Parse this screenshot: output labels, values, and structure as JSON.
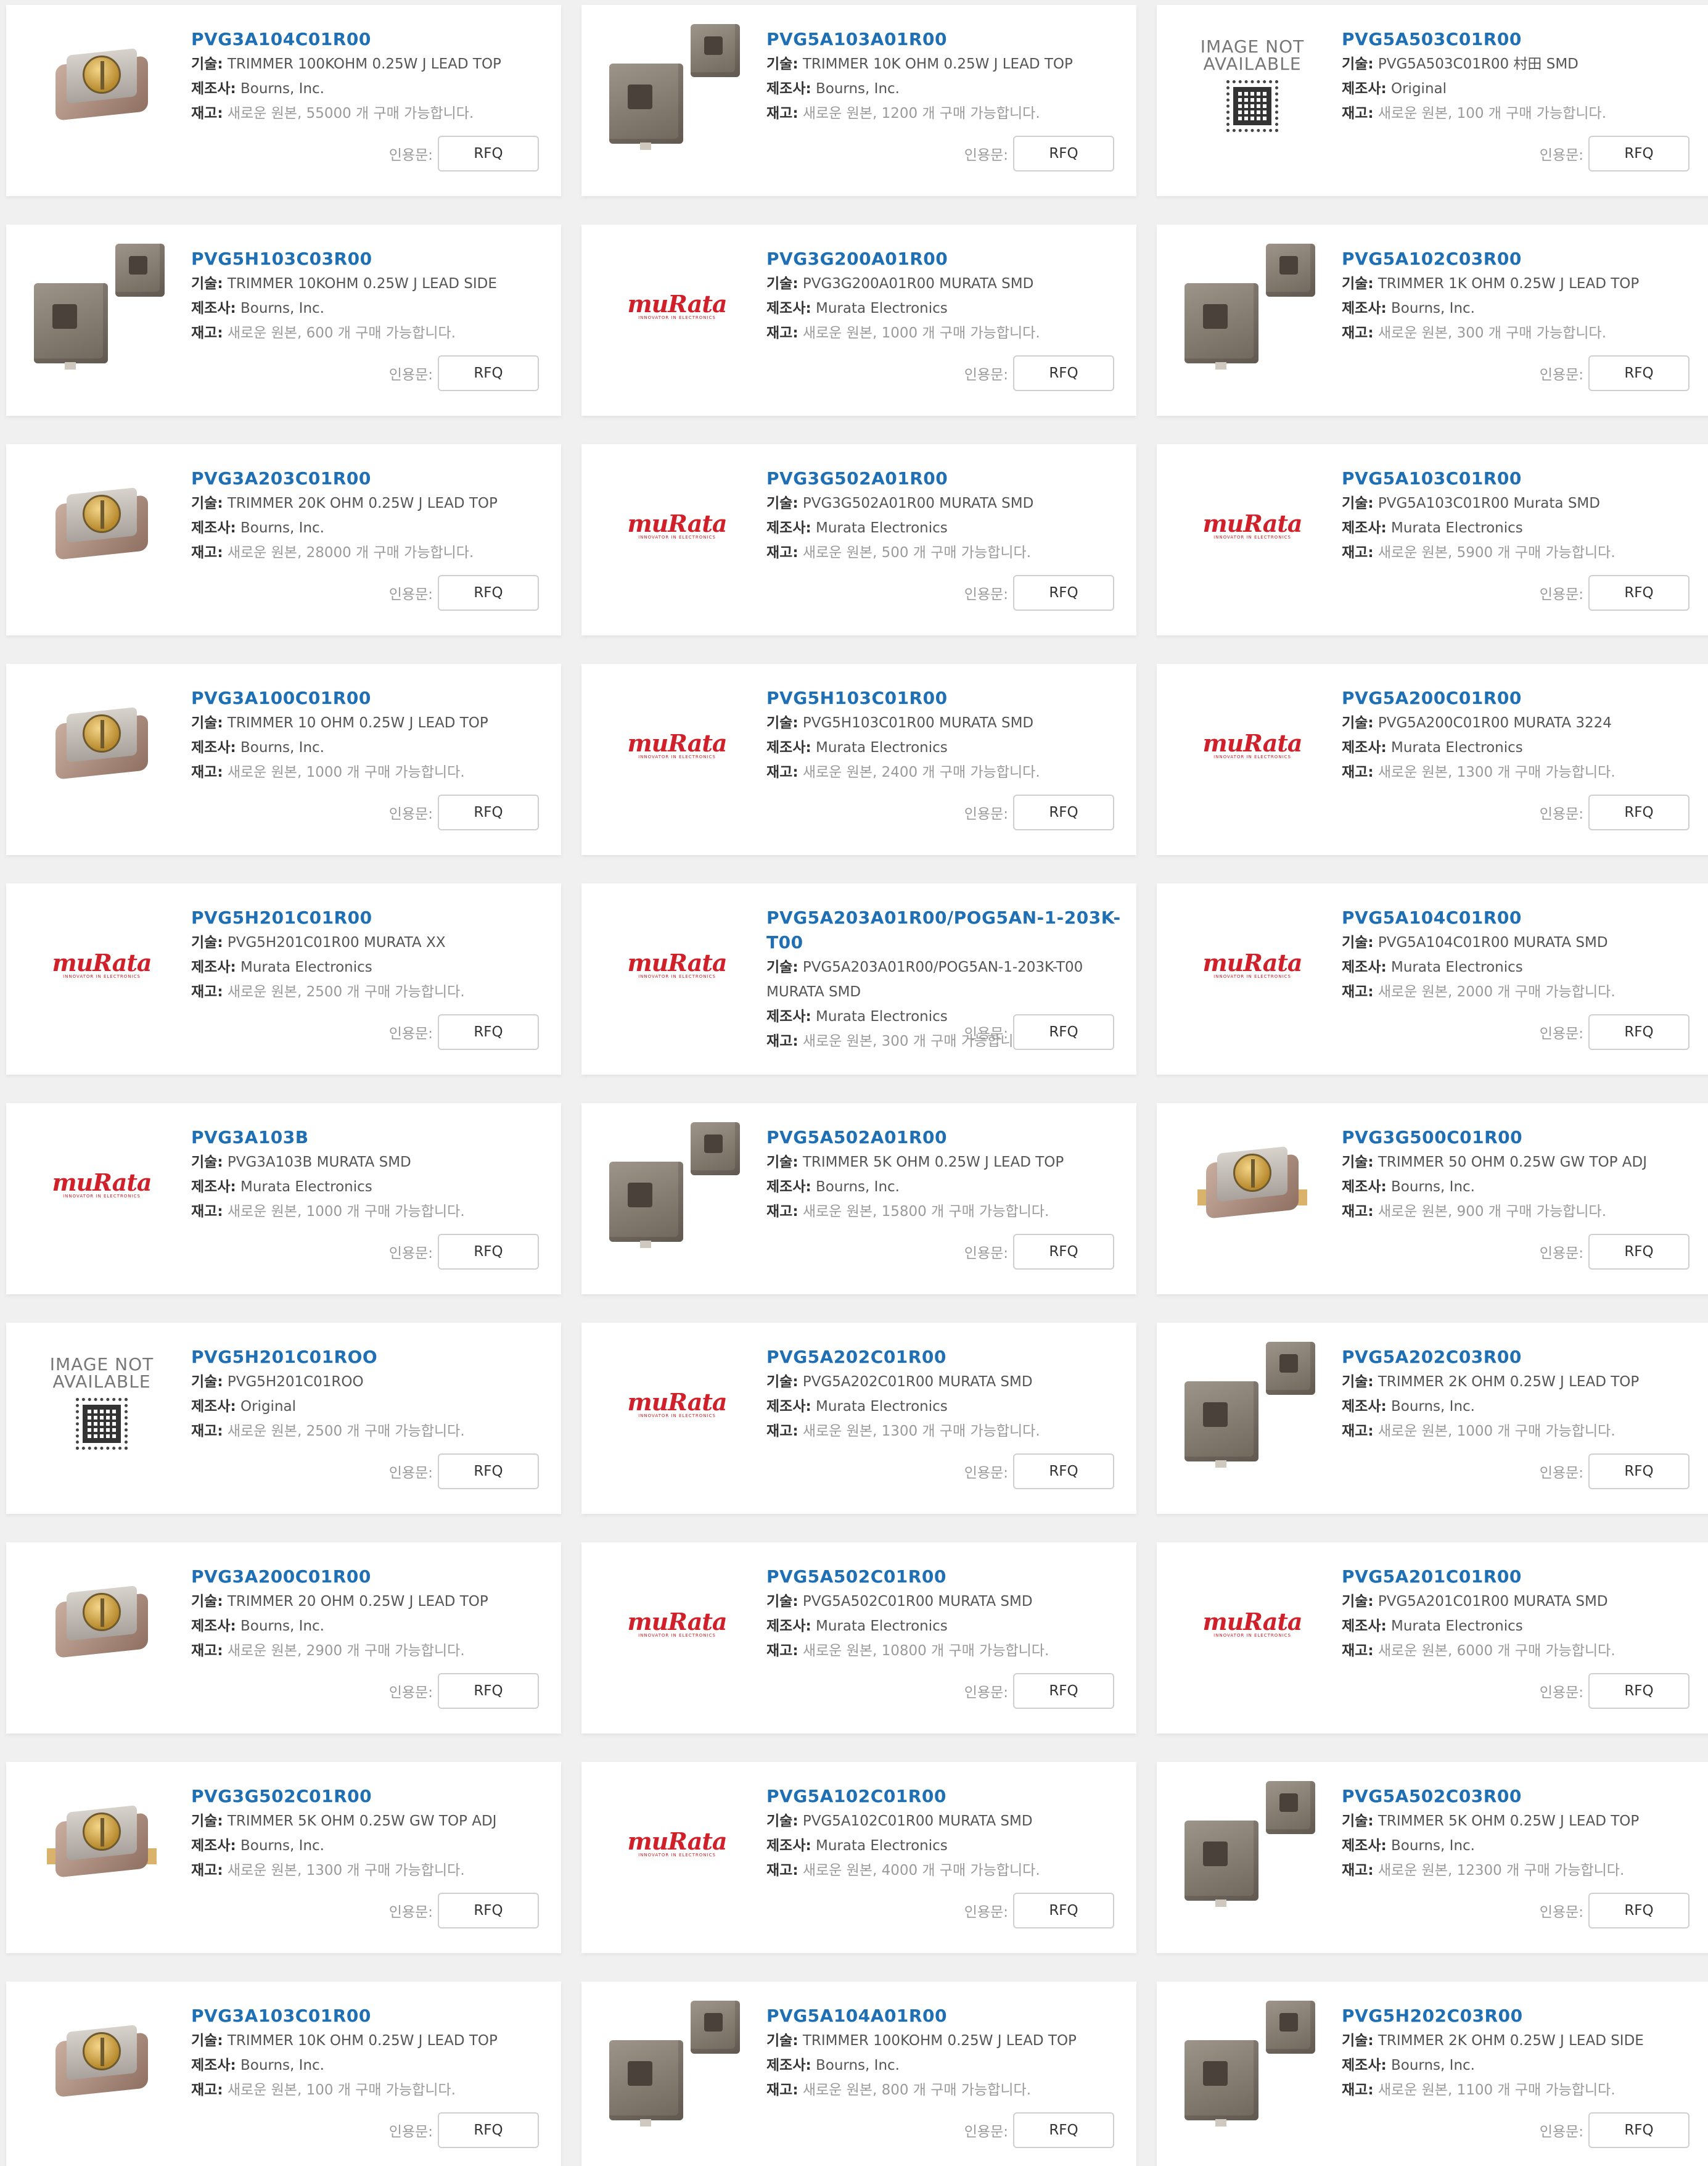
{
  "labels": {
    "tech": "기술:",
    "mfr": "제조사:",
    "stock": "재고:",
    "quote": "인용문:",
    "rfq": "RFQ",
    "na_line1": "IMAGE NOT",
    "na_line2": "AVAILABLE",
    "murata_logo": "muRata",
    "murata_tagline": "INNOVATOR IN ELECTRONICS"
  },
  "colors": {
    "part_link": "#1f6fb5",
    "murata_red": "#d0202a",
    "stock_grey": "#9a9a9a"
  },
  "products": [
    {
      "part": "PVG3A104C01R00",
      "desc": "TRIMMER 100KOHM 0.25W J LEAD TOP",
      "mfr": "Bourns, Inc.",
      "stock": "새로운 원본, 55000 개 구매 가능합니다.",
      "image": "bourns-top"
    },
    {
      "part": "PVG5A103A01R00",
      "desc": "TRIMMER 10K OHM 0.25W J LEAD TOP",
      "mfr": "Bourns, Inc.",
      "stock": "새로운 원본, 1200 개 구매 가능합니다.",
      "image": "bourns-cube"
    },
    {
      "part": "PVG5A503C01R00",
      "desc": "PVG5A503C01R00 村田 SMD",
      "mfr": "Original",
      "stock": "새로운 원본, 100 개 구매 가능합니다.",
      "image": "not-available"
    },
    {
      "part": "PVG5H103C03R00",
      "desc": "TRIMMER 10KOHM 0.25W J LEAD SIDE",
      "mfr": "Bourns, Inc.",
      "stock": "새로운 원본, 600 개 구매 가능합니다.",
      "image": "bourns-cube"
    },
    {
      "part": "PVG3G200A01R00",
      "desc": "PVG3G200A01R00 MURATA SMD",
      "mfr": "Murata Electronics",
      "stock": "새로운 원본, 1000 개 구매 가능합니다.",
      "image": "murata"
    },
    {
      "part": "PVG5A102C03R00",
      "desc": "TRIMMER 1K OHM 0.25W J LEAD TOP",
      "mfr": "Bourns, Inc.",
      "stock": "새로운 원본, 300 개 구매 가능합니다.",
      "image": "bourns-cube"
    },
    {
      "part": "PVG3A203C01R00",
      "desc": "TRIMMER 20K OHM 0.25W J LEAD TOP",
      "mfr": "Bourns, Inc.",
      "stock": "새로운 원본, 28000 개 구매 가능합니다.",
      "image": "bourns-top"
    },
    {
      "part": "PVG3G502A01R00",
      "desc": "PVG3G502A01R00 MURATA SMD",
      "mfr": "Murata Electronics",
      "stock": "새로운 원본, 500 개 구매 가능합니다.",
      "image": "murata"
    },
    {
      "part": "PVG5A103C01R00",
      "desc": "PVG5A103C01R00 Murata SMD",
      "mfr": "Murata Electronics",
      "stock": "새로운 원본, 5900 개 구매 가능합니다.",
      "image": "murata"
    },
    {
      "part": "PVG3A100C01R00",
      "desc": "TRIMMER 10 OHM 0.25W J LEAD TOP",
      "mfr": "Bourns, Inc.",
      "stock": "새로운 원본, 1000 개 구매 가능합니다.",
      "image": "bourns-top"
    },
    {
      "part": "PVG5H103C01R00",
      "desc": "PVG5H103C01R00 MURATA SMD",
      "mfr": "Murata Electronics",
      "stock": "새로운 원본, 2400 개 구매 가능합니다.",
      "image": "murata"
    },
    {
      "part": "PVG5A200C01R00",
      "desc": "PVG5A200C01R00 MURATA 3224",
      "mfr": "Murata Electronics",
      "stock": "새로운 원본, 1300 개 구매 가능합니다.",
      "image": "murata"
    },
    {
      "part": "PVG5H201C01R00",
      "desc": "PVG5H201C01R00 MURATA XX",
      "mfr": "Murata Electronics",
      "stock": "새로운 원본, 2500 개 구매 가능합니다.",
      "image": "murata"
    },
    {
      "part": "PVG5A203A01R00/POG5AN-1-203K-T00",
      "desc": "PVG5A203A01R00/POG5AN-1-203K-T00 MURATA SMD",
      "mfr": "Murata Electronics",
      "stock": "새로운 원본, 300 개 구매 가능합니다.",
      "image": "murata"
    },
    {
      "part": "PVG5A104C01R00",
      "desc": "PVG5A104C01R00 MURATA SMD",
      "mfr": "Murata Electronics",
      "stock": "새로운 원본, 2000 개 구매 가능합니다.",
      "image": "murata"
    },
    {
      "part": "PVG3A103B",
      "desc": "PVG3A103B MURATA SMD",
      "mfr": "Murata Electronics",
      "stock": "새로운 원본, 1000 개 구매 가능합니다.",
      "image": "murata"
    },
    {
      "part": "PVG5A502A01R00",
      "desc": "TRIMMER 5K OHM 0.25W J LEAD TOP",
      "mfr": "Bourns, Inc.",
      "stock": "새로운 원본, 15800 개 구매 가능합니다.",
      "image": "bourns-cube"
    },
    {
      "part": "PVG3G500C01R00",
      "desc": "TRIMMER 50 OHM 0.25W GW TOP ADJ",
      "mfr": "Bourns, Inc.",
      "stock": "새로운 원본, 900 개 구매 가능합니다.",
      "image": "bourns-wing"
    },
    {
      "part": "PVG5H201C01ROO",
      "desc": "PVG5H201C01ROO",
      "mfr": "Original",
      "stock": "새로운 원본, 2500 개 구매 가능합니다.",
      "image": "not-available"
    },
    {
      "part": "PVG5A202C01R00",
      "desc": "PVG5A202C01R00 MURATA SMD",
      "mfr": "Murata Electronics",
      "stock": "새로운 원본, 1300 개 구매 가능합니다.",
      "image": "murata"
    },
    {
      "part": "PVG5A202C03R00",
      "desc": "TRIMMER 2K OHM 0.25W J LEAD TOP",
      "mfr": "Bourns, Inc.",
      "stock": "새로운 원본, 1000 개 구매 가능합니다.",
      "image": "bourns-cube"
    },
    {
      "part": "PVG3A200C01R00",
      "desc": "TRIMMER 20 OHM 0.25W J LEAD TOP",
      "mfr": "Bourns, Inc.",
      "stock": "새로운 원본, 2900 개 구매 가능합니다.",
      "image": "bourns-top"
    },
    {
      "part": "PVG5A502C01R00",
      "desc": "PVG5A502C01R00 MURATA SMD",
      "mfr": "Murata Electronics",
      "stock": "새로운 원본, 10800 개 구매 가능합니다.",
      "image": "murata"
    },
    {
      "part": "PVG5A201C01R00",
      "desc": "PVG5A201C01R00 MURATA SMD",
      "mfr": "Murata Electronics",
      "stock": "새로운 원본, 6000 개 구매 가능합니다.",
      "image": "murata"
    },
    {
      "part": "PVG3G502C01R00",
      "desc": "TRIMMER 5K OHM 0.25W GW TOP ADJ",
      "mfr": "Bourns, Inc.",
      "stock": "새로운 원본, 1300 개 구매 가능합니다.",
      "image": "bourns-wing"
    },
    {
      "part": "PVG5A102C01R00",
      "desc": "PVG5A102C01R00 MURATA SMD",
      "mfr": "Murata Electronics",
      "stock": "새로운 원본, 4000 개 구매 가능합니다.",
      "image": "murata"
    },
    {
      "part": "PVG5A502C03R00",
      "desc": "TRIMMER 5K OHM 0.25W J LEAD TOP",
      "mfr": "Bourns, Inc.",
      "stock": "새로운 원본, 12300 개 구매 가능합니다.",
      "image": "bourns-cube"
    },
    {
      "part": "PVG3A103C01R00",
      "desc": "TRIMMER 10K OHM 0.25W J LEAD TOP",
      "mfr": "Bourns, Inc.",
      "stock": "새로운 원본, 100 개 구매 가능합니다.",
      "image": "bourns-top"
    },
    {
      "part": "PVG5A104A01R00",
      "desc": "TRIMMER 100KOHM 0.25W J LEAD TOP",
      "mfr": "Bourns, Inc.",
      "stock": "새로운 원본, 800 개 구매 가능합니다.",
      "image": "bourns-cube"
    },
    {
      "part": "PVG5H202C03R00",
      "desc": "TRIMMER 2K OHM 0.25W J LEAD SIDE",
      "mfr": "Bourns, Inc.",
      "stock": "새로운 원본, 1100 개 구매 가능합니다.",
      "image": "bourns-cube"
    }
  ]
}
